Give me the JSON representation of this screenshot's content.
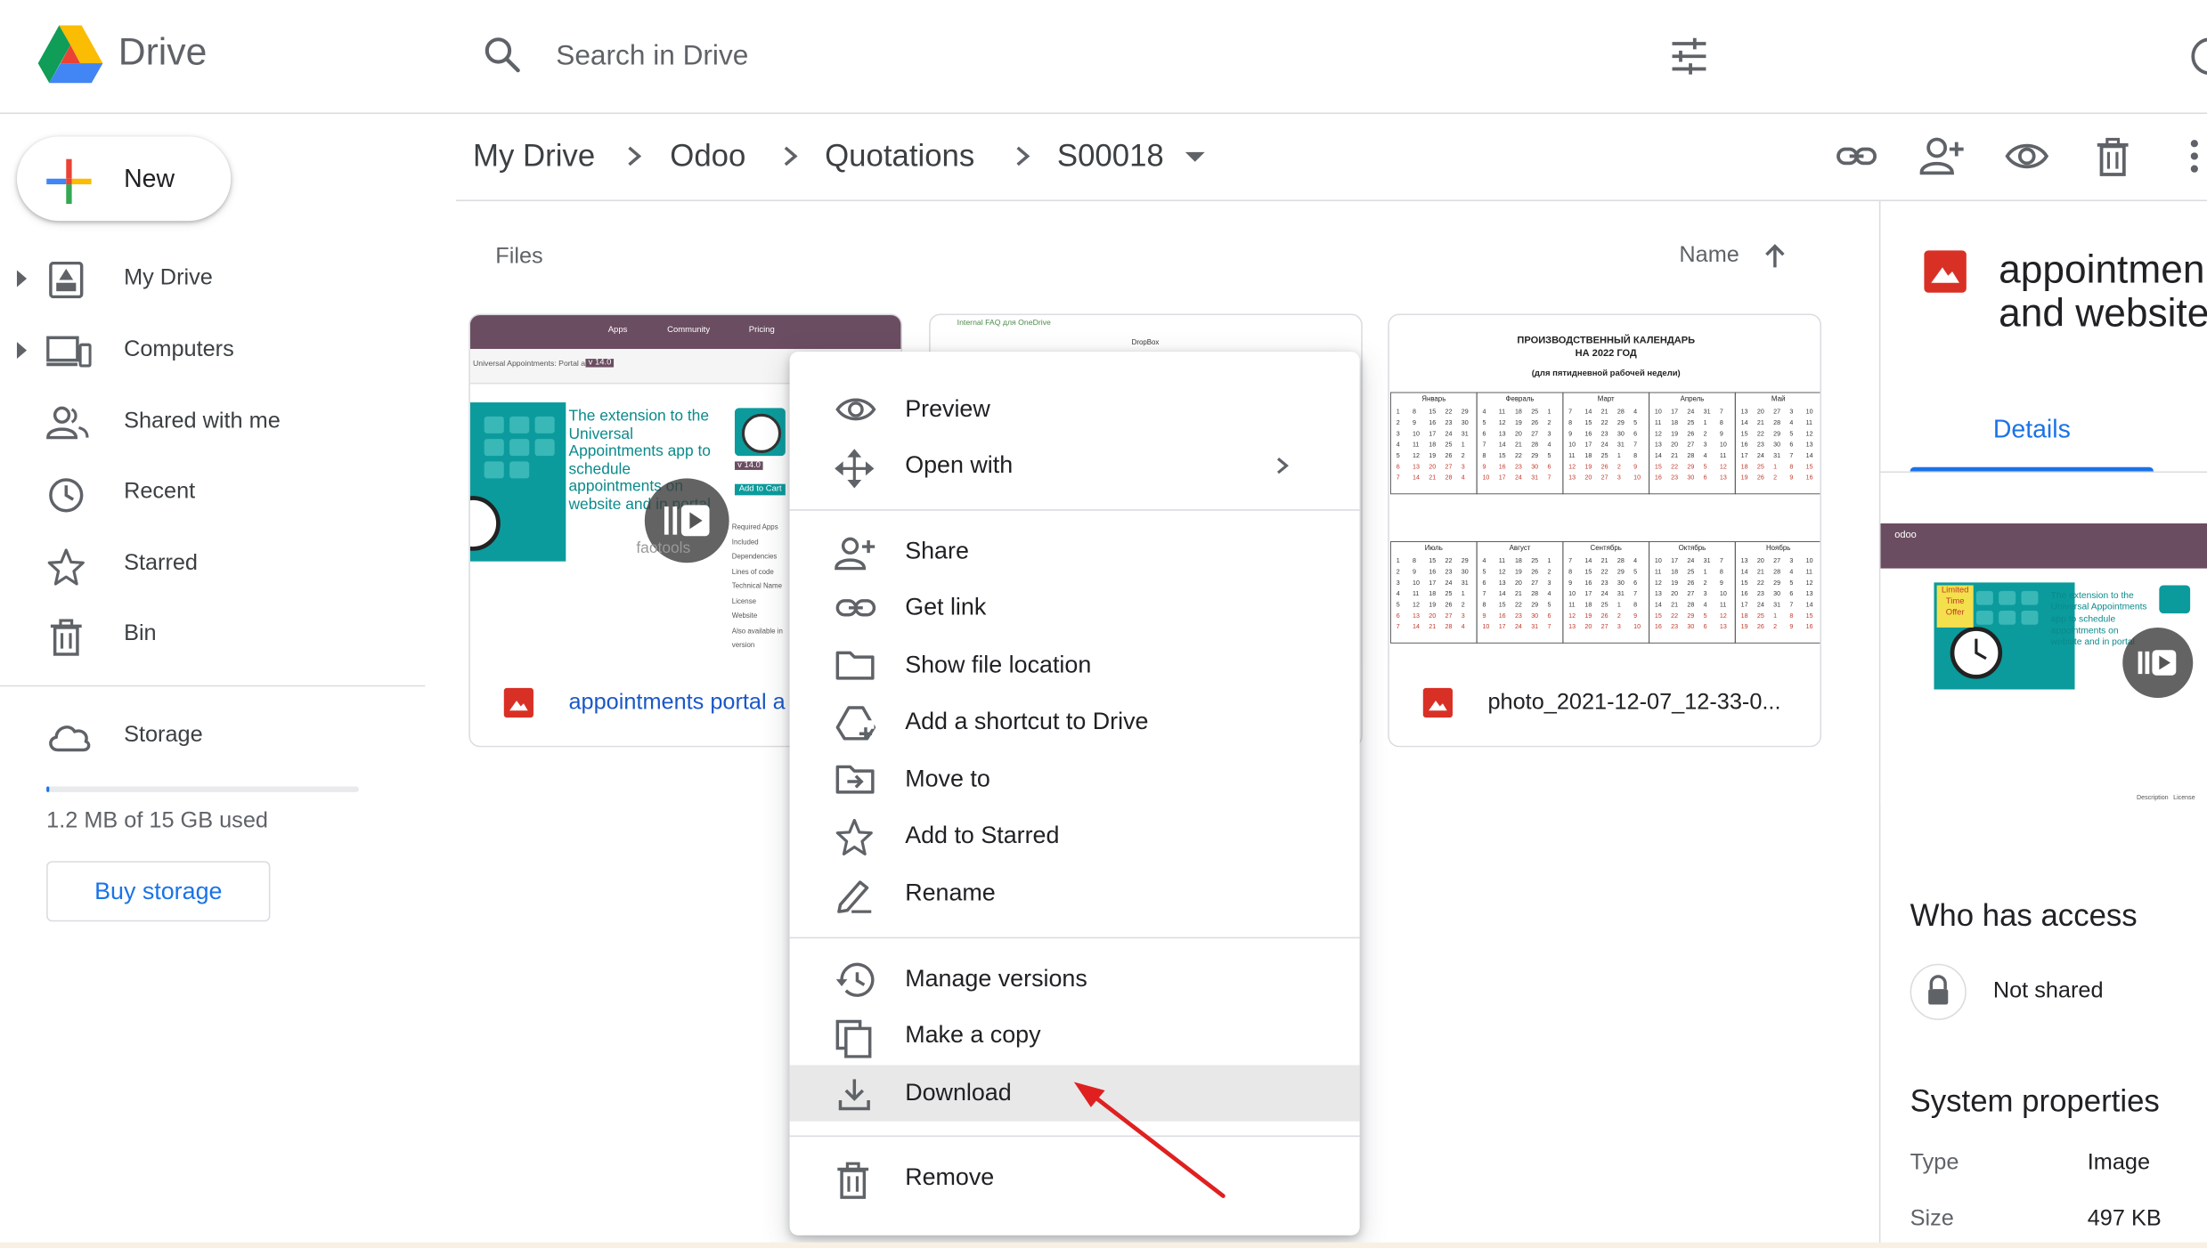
{
  "app": {
    "title": "Drive"
  },
  "search": {
    "placeholder": "Search in Drive"
  },
  "sidebar": {
    "new_label": "New",
    "items": [
      {
        "label": "My Drive"
      },
      {
        "label": "Computers"
      },
      {
        "label": "Shared with me"
      },
      {
        "label": "Recent"
      },
      {
        "label": "Starred"
      },
      {
        "label": "Bin"
      }
    ],
    "storage_label": "Storage",
    "storage_used": "1.2 MB of 15 GB used",
    "storage_fraction": 0.0001,
    "buy_label": "Buy storage"
  },
  "breadcrumb": [
    "My Drive",
    "Odoo",
    "Quotations",
    "S00018"
  ],
  "files": {
    "section_label": "Files",
    "sort_label": "Name",
    "cards": [
      {
        "name": "appointments portal a",
        "thumb": {
          "nav": [
            "Apps",
            "Community",
            "Pricing"
          ],
          "subbar": "Universal Appointments: Portal a...",
          "version": "v 14.0",
          "promo": "The extension to the Universal Appointments app to schedule appointments on website and in portal",
          "add_to_cart": "Add to Cart",
          "side_list": [
            "Required Apps",
            "Included Dependencies",
            "Lines of code",
            "Technical Name",
            "License",
            "Website",
            "Also available in version"
          ],
          "brand": "faotools"
        }
      },
      {
        "name": "",
        "thumb": {
          "line1": "Internal FAQ для OneDrive",
          "line2": "DropBox"
        }
      },
      {
        "name": "photo_2021-12-07_12-33-0...",
        "thumb": {
          "title1": "ПРОИЗВОДСТВЕННЫЙ КАЛЕНДАРЬ",
          "title2": "НА 2022 ГОД",
          "title3": "(для пятидневной рабочей недели)",
          "months_top": [
            "Январь",
            "Февраль",
            "Март",
            "Апрель",
            "Май"
          ],
          "months_bottom": [
            "Июль",
            "Август",
            "Сентябрь",
            "Октябрь",
            "Ноябрь"
          ]
        }
      }
    ]
  },
  "context_menu": {
    "items": [
      {
        "label": "Preview",
        "icon": "eye-icon"
      },
      {
        "label": "Open with",
        "icon": "move-icon",
        "submenu": true
      },
      {
        "label": "Share",
        "icon": "person-add-icon"
      },
      {
        "label": "Get link",
        "icon": "link-icon"
      },
      {
        "label": "Show file location",
        "icon": "folder-icon"
      },
      {
        "label": "Add a shortcut to Drive",
        "icon": "drive-shortcut-icon"
      },
      {
        "label": "Move to",
        "icon": "move-to-folder-icon"
      },
      {
        "label": "Add to Starred",
        "icon": "star-icon"
      },
      {
        "label": "Rename",
        "icon": "pencil-icon"
      },
      {
        "label": "Manage versions",
        "icon": "history-icon"
      },
      {
        "label": "Make a copy",
        "icon": "copy-icon"
      },
      {
        "label": "Download",
        "icon": "download-icon",
        "highlighted": true
      },
      {
        "label": "Remove",
        "icon": "trash-icon"
      }
    ]
  },
  "details": {
    "title_line1": "appointmen",
    "title_line2": "and website",
    "tab_label": "Details",
    "thumb": {
      "brand": "odoo",
      "badge": "Limited Time Offer",
      "promo": "The extension to the Universal Appointments app to schedule appointments on website and in portal",
      "footer_left": "Description",
      "footer_right": "License"
    },
    "access_heading": "Who has access",
    "access_value": "Not shared",
    "system_heading": "System properties",
    "props": [
      {
        "key": "Type",
        "value": "Image"
      },
      {
        "key": "Size",
        "value": "497 KB"
      }
    ]
  },
  "colors": {
    "accent": "#1a73e8",
    "image_icon": "#d93025",
    "teal": "#0b9b9c",
    "odoo_purple": "#6b4d61",
    "annotation_arrow": "#e02020"
  }
}
